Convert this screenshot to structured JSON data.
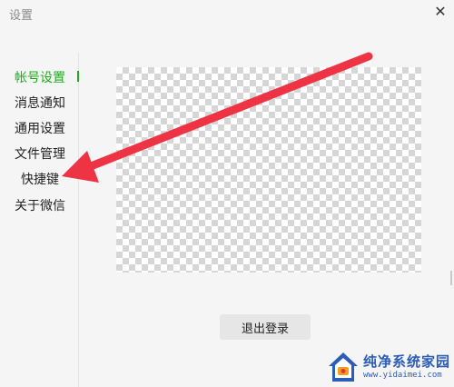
{
  "window": {
    "title": "设置",
    "close_glyph": "✕"
  },
  "sidebar": {
    "items": [
      {
        "label": "帐号设置",
        "active": true
      },
      {
        "label": "消息通知",
        "active": false
      },
      {
        "label": "通用设置",
        "active": false
      },
      {
        "label": "文件管理",
        "active": false
      },
      {
        "label": "快捷键",
        "active": false
      },
      {
        "label": "关于微信",
        "active": false
      }
    ]
  },
  "main": {
    "logout_label": "退出登录"
  },
  "annotation": {
    "arrow_color": "#ee3344",
    "points_to": "快捷键"
  },
  "watermark": {
    "title": "纯净系统家园",
    "url": "www.yidaimei.com"
  },
  "colors": {
    "accent": "#1aad19",
    "background": "#f5f5f5",
    "button_bg": "#e6e6e6"
  }
}
